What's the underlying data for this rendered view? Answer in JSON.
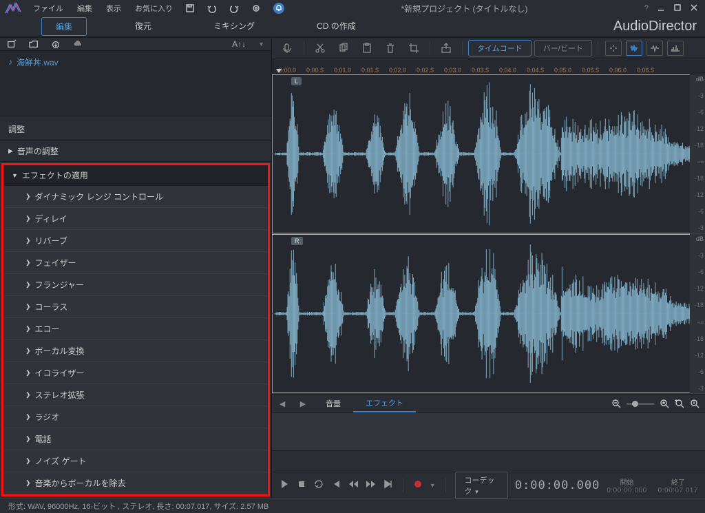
{
  "menus": [
    "ファイル",
    "編集",
    "表示",
    "お気に入り"
  ],
  "project_title": "*新規プロジェクト (タイトルなし)",
  "app_name": "AudioDirector",
  "mode_tabs": {
    "edit": "編集",
    "restore": "復元",
    "mix": "ミキシング",
    "cd": "CD の作成"
  },
  "library": {
    "font_btn": "A↑↓",
    "file": "海鮮丼.wav"
  },
  "adjust_header": "調整",
  "sections": {
    "voice_adjust": "音声の調整",
    "effects_apply": "エフェクトの適用"
  },
  "effects": [
    "ダイナミック レンジ コントロール",
    "ディレイ",
    "リバーブ",
    "フェイザー",
    "フランジャー",
    "コーラス",
    "エコー",
    "ボーカル変換",
    "イコライザー",
    "ステレオ拡張",
    "ラジオ",
    "電話",
    "ノイズ ゲート",
    "音楽からボーカルを除去"
  ],
  "toolbar": {
    "timecode": "タイムコード",
    "barbeat": "バー/ビート"
  },
  "ruler": [
    "0:00.0",
    "0:00.5",
    "0:01.0",
    "0:01.5",
    "0:02.0",
    "0:02.5",
    "0:03.0",
    "0:03.5",
    "0:04.0",
    "0:04.5",
    "0:05.0",
    "0:05.5",
    "0:06.0",
    "0:06.5"
  ],
  "db": {
    "header": "dB",
    "ticks": [
      "-3",
      "-6",
      "-12",
      "-18",
      "-∞",
      "-18",
      "-12",
      "-6",
      "-3"
    ]
  },
  "channels": {
    "left": "L",
    "right": "R"
  },
  "lanes": {
    "volume": "音量",
    "effect": "エフェクト"
  },
  "transport": {
    "codec": "コーデック",
    "time": "0:00:00.000",
    "start_label": "開始",
    "end_label": "終了",
    "start_val": "0:00:00.000",
    "end_val": "0:00:07.017"
  },
  "status": "形式: WAV,  96000Hz,  16-ビット , ステレオ, 長さ:  00:07.017, サイズ: 2.57 MB"
}
